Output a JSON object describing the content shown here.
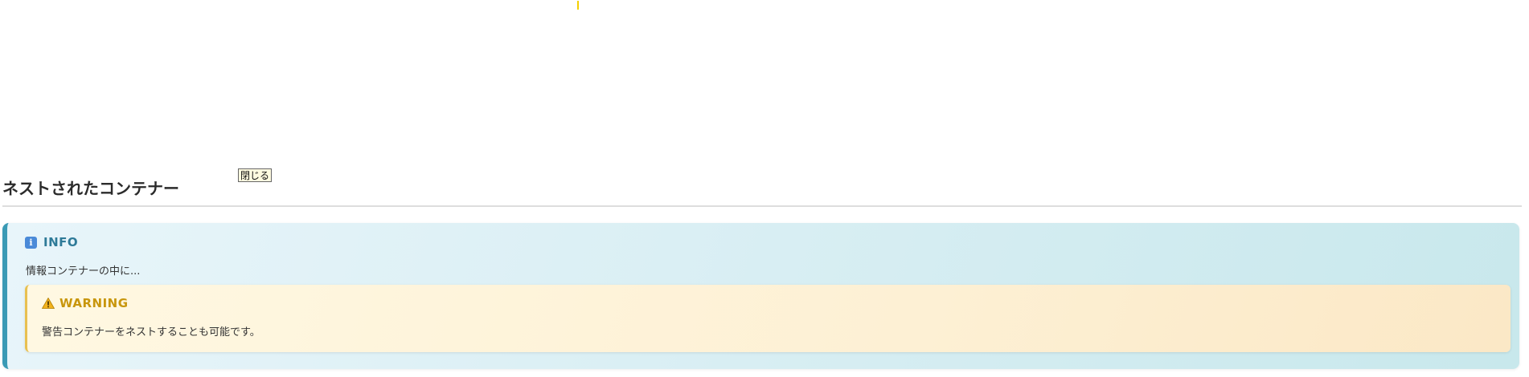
{
  "close_button_label": "閉じる",
  "section": {
    "title": "ネストされたコンテナー"
  },
  "info": {
    "icon": "info-icon",
    "label": "INFO",
    "text": "情報コンテナーの中に..."
  },
  "warning": {
    "icon": "warning-triangle-icon",
    "label": "WARNING",
    "text": "警告コンテナーをネストすることも可能です。"
  },
  "colors": {
    "info_accent": "#3a9ab5",
    "info_label": "#2e7a98",
    "warning_accent": "#e8c050",
    "warning_label": "#c8960c"
  }
}
